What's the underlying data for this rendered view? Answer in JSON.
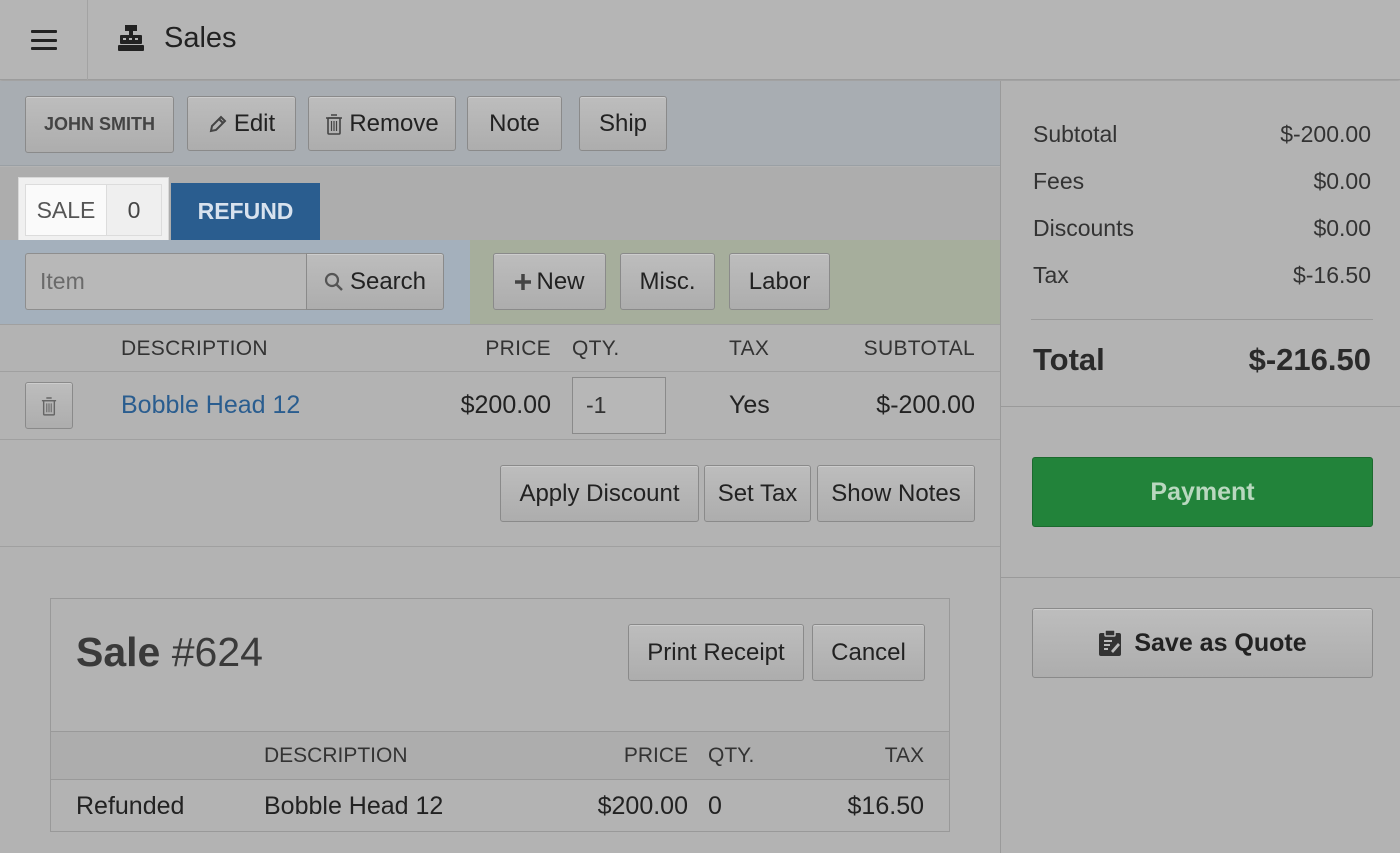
{
  "header": {
    "menu_icon": "hamburger-icon",
    "app_icon": "cash-register-icon",
    "title": "Sales"
  },
  "customer_bar": {
    "customer_name": "JOHN SMITH",
    "edit_label": "Edit",
    "remove_label": "Remove",
    "note_label": "Note",
    "ship_label": "Ship"
  },
  "mode_tabs": {
    "sale_label": "SALE",
    "sale_count": "0",
    "refund_label": "REFUND"
  },
  "item_search": {
    "placeholder": "Item",
    "search_label": "Search",
    "new_label": "New",
    "misc_label": "Misc.",
    "labor_label": "Labor"
  },
  "line_table": {
    "headers": {
      "description": "DESCRIPTION",
      "price": "PRICE",
      "qty": "QTY.",
      "tax": "TAX",
      "subtotal": "SUBTOTAL"
    },
    "rows": [
      {
        "description": "Bobble Head 12",
        "price": "$200.00",
        "qty": "-1",
        "tax": "Yes",
        "subtotal": "$-200.00"
      }
    ]
  },
  "line_actions": {
    "apply_discount": "Apply Discount",
    "set_tax": "Set Tax",
    "show_notes": "Show Notes"
  },
  "receipt": {
    "title_prefix": "Sale",
    "number": "#624",
    "print_label": "Print Receipt",
    "cancel_label": "Cancel",
    "headers": {
      "description": "DESCRIPTION",
      "price": "PRICE",
      "qty": "QTY.",
      "tax": "TAX"
    },
    "rows": [
      {
        "status": "Refunded",
        "description": "Bobble Head 12",
        "price": "$200.00",
        "qty": "0",
        "tax": "$16.50"
      }
    ]
  },
  "summary": {
    "subtotal_label": "Subtotal",
    "subtotal": "$-200.00",
    "fees_label": "Fees",
    "fees": "$0.00",
    "discounts_label": "Discounts",
    "discounts": "$0.00",
    "tax_label": "Tax",
    "tax": "$-16.50",
    "total_label": "Total",
    "total": "$-216.50",
    "payment_label": "Payment",
    "quote_label": "Save as Quote"
  },
  "colors": {
    "refund_tab": "#2a5d8f",
    "payment_button": "#22833a",
    "link": "#2a5d8f"
  }
}
